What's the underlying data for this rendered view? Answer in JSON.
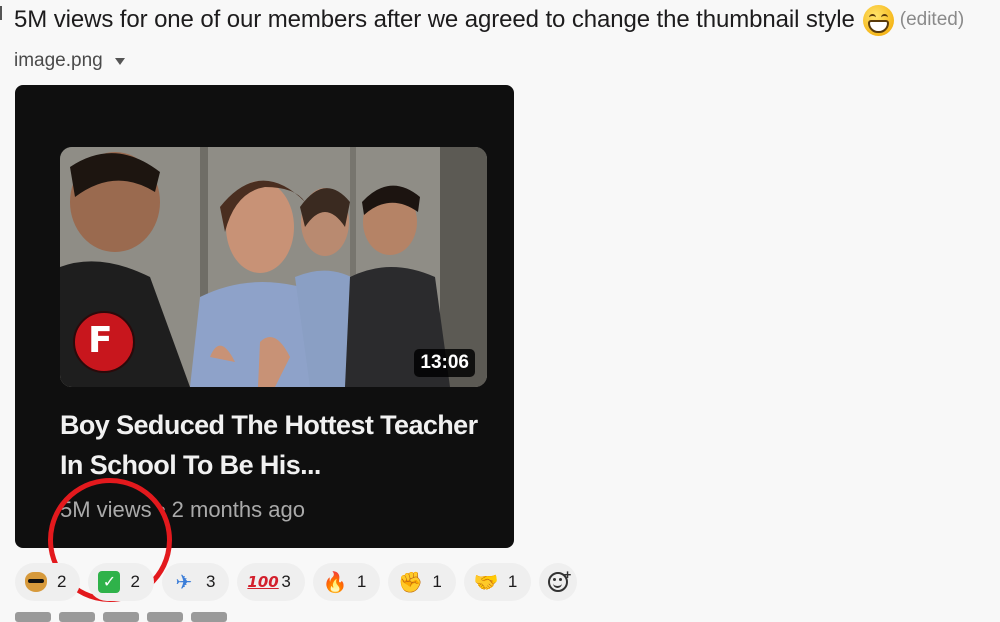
{
  "message": {
    "text": "5M views for one of our members after we agreed to change the thumbnail style",
    "emoji": "grinning-face-with-smiling-eyes",
    "edited_label": "(edited)"
  },
  "file": {
    "name": "image.png"
  },
  "video_card": {
    "duration": "13:06",
    "channel_logo_letter": "F",
    "title": "Boy Seduced The Hottest Teacher In School To Be His...",
    "views": "5M views",
    "separator": "•",
    "age": "2 months ago",
    "highlight_color": "#e3191d"
  },
  "reactions": [
    {
      "emoji": "dog-sunglasses",
      "glyph": "",
      "count": "2"
    },
    {
      "emoji": "white-check-mark",
      "glyph": "✓",
      "count": "2"
    },
    {
      "emoji": "airplane",
      "glyph": "✈",
      "count": "3"
    },
    {
      "emoji": "hundred-points",
      "glyph": "100",
      "count": "3"
    },
    {
      "emoji": "fire",
      "glyph": "🔥",
      "count": "1"
    },
    {
      "emoji": "fist-bump",
      "glyph": "✊",
      "count": "1"
    },
    {
      "emoji": "handshake",
      "glyph": "🤝",
      "count": "1"
    }
  ],
  "colors": {
    "background": "#f8f8f8",
    "card": "#0f0f0f",
    "reaction_pill": "#efefef"
  }
}
